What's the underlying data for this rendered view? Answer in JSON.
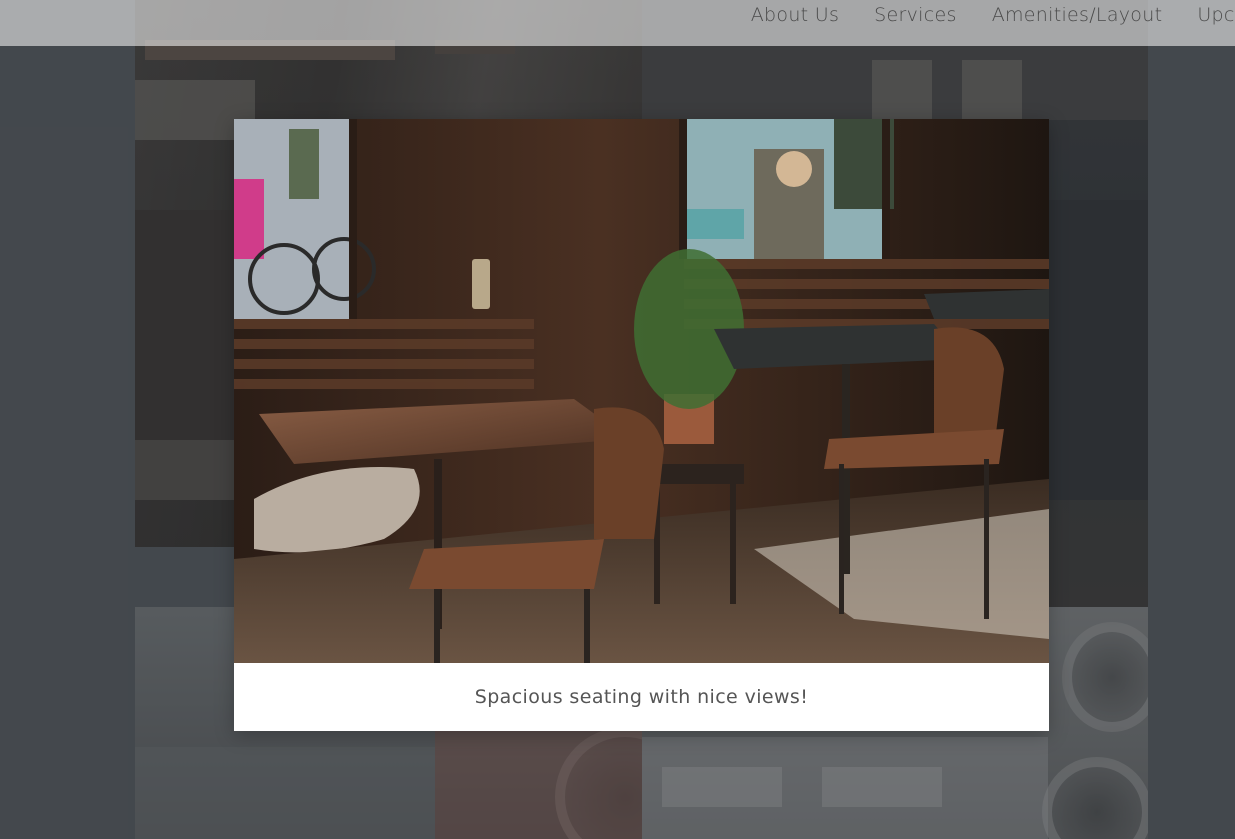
{
  "nav": {
    "items": [
      {
        "label": "About Us"
      },
      {
        "label": "Services"
      },
      {
        "label": "Amenities/Layout"
      },
      {
        "label": "Upcoming"
      }
    ]
  },
  "lightbox": {
    "caption": "Spacious seating with nice views!"
  },
  "colors": {
    "overlay": "#4a4f55",
    "navbar": "#f5f5f5",
    "caption_text": "#555555"
  }
}
